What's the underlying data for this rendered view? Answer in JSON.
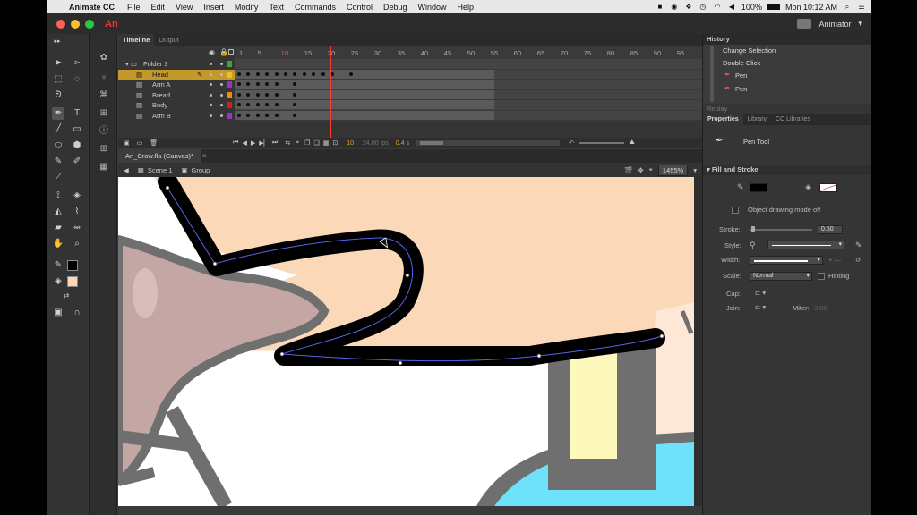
{
  "menubar": {
    "app_name": "Animate CC",
    "items": [
      "File",
      "Edit",
      "View",
      "Insert",
      "Modify",
      "Text",
      "Commands",
      "Control",
      "Debug",
      "Window",
      "Help"
    ],
    "battery": "100%",
    "clock": "Mon 10:12 AM"
  },
  "titlebar": {
    "logo": "An",
    "workspace": "Animator"
  },
  "timeline": {
    "tabs": [
      "Timeline",
      "Output"
    ],
    "frame_numbers": [
      "1",
      "5",
      "10",
      "15",
      "20",
      "25",
      "30",
      "35",
      "40",
      "45",
      "50",
      "55",
      "60",
      "65",
      "70",
      "75",
      "80",
      "85",
      "90",
      "95"
    ],
    "layers": [
      {
        "name": "Folder 3",
        "color": "#33aa33",
        "selected": false,
        "folder": true
      },
      {
        "name": "Head",
        "color": "#e8c020",
        "selected": true,
        "folder": false
      },
      {
        "name": "Arm A",
        "color": "#9933cc",
        "selected": false,
        "folder": false
      },
      {
        "name": "Bread",
        "color": "#ff8800",
        "selected": false,
        "folder": false
      },
      {
        "name": "Body",
        "color": "#cc2222",
        "selected": false,
        "folder": false
      },
      {
        "name": "Arm B",
        "color": "#9933cc",
        "selected": false,
        "folder": false
      }
    ],
    "current_frame": "10",
    "fps": "24.00 fps",
    "time": "0.4 s"
  },
  "document": {
    "tab": "An_Crow.fla (Canvas)*",
    "scene": "Scene 1",
    "group": "Group",
    "zoom": "1455%"
  },
  "history": {
    "title": "History",
    "items": [
      "Change Selection",
      "Double Click",
      "Pen",
      "Pen"
    ],
    "replay": "Replay"
  },
  "properties": {
    "tabs": [
      "Properties",
      "Library",
      "CC Libraries"
    ],
    "tool_name": "Pen Tool",
    "fill_stroke_title": "Fill and Stroke",
    "object_drawing": "Object drawing mode off",
    "stroke_label": "Stroke:",
    "stroke_value": "0.50",
    "style_label": "Style:",
    "width_label": "Width:",
    "scale_label": "Scale:",
    "scale_value": "Normal",
    "hinting": "Hinting",
    "cap_label": "Cap:",
    "join_label": "Join:",
    "miter_label": "Miter:",
    "miter_value": "3.00",
    "stroke_color": "#000000"
  }
}
